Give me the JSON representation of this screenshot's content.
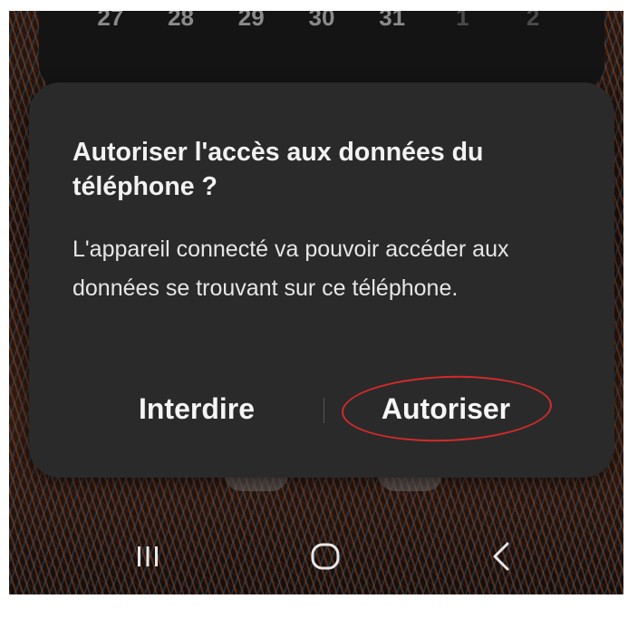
{
  "calendar": {
    "days": [
      "27",
      "28",
      "29",
      "30",
      "31",
      "1",
      "2"
    ]
  },
  "dialog": {
    "title": "Autoriser l'accès aux données du téléphone ?",
    "message": "L'appareil connecté va pouvoir accéder aux données se trouvant sur ce téléphone.",
    "deny_label": "Interdire",
    "allow_label": "Autoriser"
  },
  "navbar": {
    "recents_icon": "recents-icon",
    "home_icon": "home-icon",
    "back_icon": "back-icon"
  },
  "colors": {
    "dialog_bg": "#2a2a2a",
    "text": "#f2f2f2",
    "highlight": "#d42a2a"
  }
}
